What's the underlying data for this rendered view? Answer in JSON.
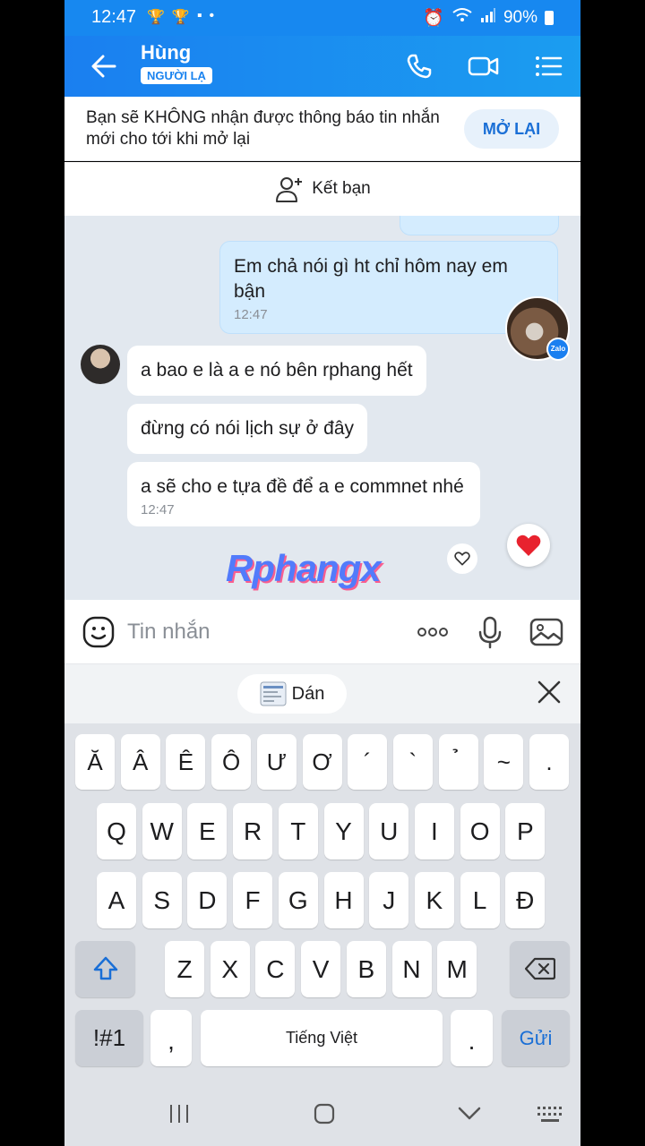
{
  "status": {
    "time": "12:47",
    "battery": "90%"
  },
  "header": {
    "name": "Hùng",
    "badge": "NGƯỜI LẠ"
  },
  "notice": {
    "text": "Bạn sẽ KHÔNG nhận được thông báo tin nhắn mới cho tới khi mở lại",
    "button": "MỞ LẠI"
  },
  "add_friend": {
    "label": "Kết bạn"
  },
  "messages": [
    {
      "direction": "out",
      "text": "Em chả nói gì ht chỉ hôm nay em bận",
      "time": "12:47"
    },
    {
      "direction": "in",
      "text": "a bao e là a e nó bên rphang hết"
    },
    {
      "direction": "in",
      "text": "đừng có nói lịch sự ở đây"
    },
    {
      "direction": "in",
      "text": "a sẽ cho e tựa đề để a e commnet nhé",
      "time": "12:47"
    }
  ],
  "avatar_badge": "Zalo",
  "watermark": "Rphangx",
  "input": {
    "placeholder": "Tin nhắn"
  },
  "clipboard": {
    "paste_label": "Dán"
  },
  "keyboard": {
    "row0": [
      "Ă",
      "Â",
      "Ê",
      "Ô",
      "Ư",
      "Ơ",
      "´",
      "`",
      "̉",
      "~",
      "."
    ],
    "row1": [
      "Q",
      "W",
      "E",
      "R",
      "T",
      "Y",
      "U",
      "I",
      "O",
      "P"
    ],
    "row2": [
      "A",
      "S",
      "D",
      "F",
      "G",
      "H",
      "J",
      "K",
      "L",
      "Đ"
    ],
    "row3": [
      "Z",
      "X",
      "C",
      "V",
      "B",
      "N",
      "M"
    ],
    "symbols": "!#1",
    "comma": ",",
    "space": "Tiếng Việt",
    "period": ".",
    "send": "Gửi"
  },
  "colors": {
    "accent": "#1a7ff0",
    "bubble_out": "#d4ecfe",
    "chat_bg": "#e2e8ef"
  }
}
